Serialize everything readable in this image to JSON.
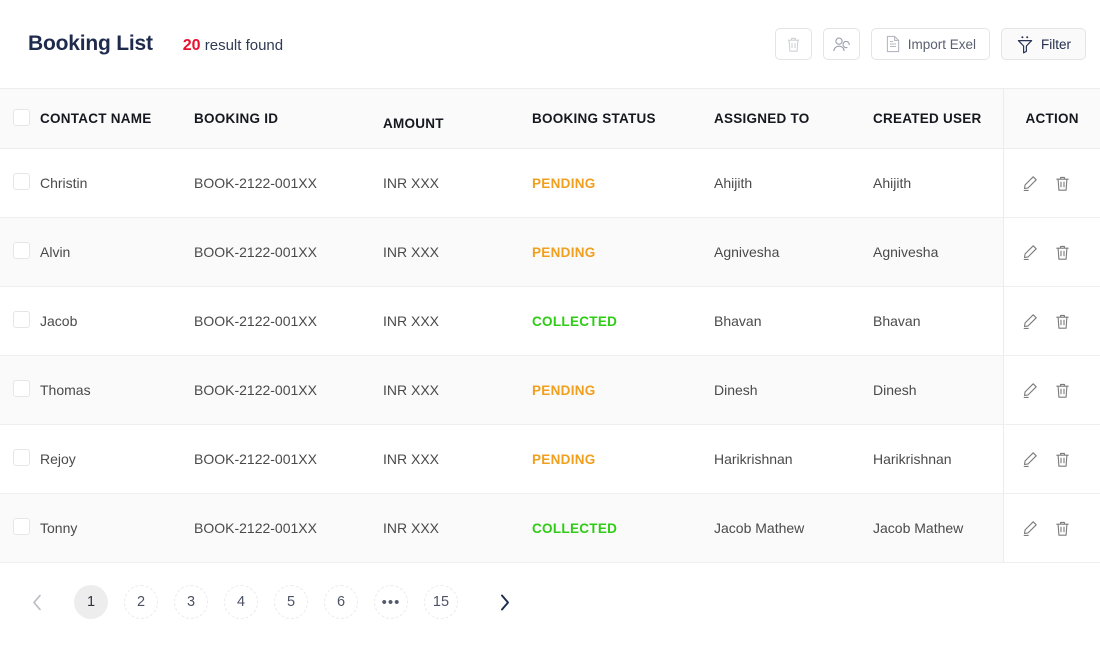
{
  "header": {
    "title": "Booking List",
    "result_count": "20",
    "result_text": "result found"
  },
  "toolbar": {
    "delete_label": "",
    "assign_label": "",
    "import_label": "Import Exel",
    "filter_label": "Filter",
    "icons": {
      "delete": "trash-icon",
      "assign": "assign-user-icon",
      "import": "document-icon",
      "filter": "funnel-icon"
    }
  },
  "table": {
    "columns": [
      "CONTACT NAME",
      "BOOKING ID",
      "AMOUNT",
      "BOOKING STATUS",
      "ASSIGNED TO",
      "CREATED USER",
      "ACTION"
    ],
    "rows": [
      {
        "name": "Christin",
        "booking_id": "BOOK-2122-001XX",
        "amount": "INR XXX",
        "status": "PENDING",
        "status_kind": "pending",
        "assigned_to": "Ahijith",
        "created_user": "Ahijith"
      },
      {
        "name": "Alvin",
        "booking_id": "BOOK-2122-001XX",
        "amount": "INR XXX",
        "status": "PENDING",
        "status_kind": "pending",
        "assigned_to": "Agnivesha",
        "created_user": "Agnivesha"
      },
      {
        "name": "Jacob",
        "booking_id": "BOOK-2122-001XX",
        "amount": "INR XXX",
        "status": "COLLECTED",
        "status_kind": "collected",
        "assigned_to": "Bhavan",
        "created_user": "Bhavan"
      },
      {
        "name": "Thomas",
        "booking_id": "BOOK-2122-001XX",
        "amount": "INR XXX",
        "status": "PENDING",
        "status_kind": "pending",
        "assigned_to": "Dinesh",
        "created_user": "Dinesh"
      },
      {
        "name": "Rejoy",
        "booking_id": "BOOK-2122-001XX",
        "amount": "INR XXX",
        "status": "PENDING",
        "status_kind": "pending",
        "assigned_to": "Harikrishnan",
        "created_user": "Harikrishnan"
      },
      {
        "name": "Tonny",
        "booking_id": "BOOK-2122-001XX",
        "amount": "INR XXX",
        "status": "COLLECTED",
        "status_kind": "collected",
        "assigned_to": "Jacob Mathew",
        "created_user": "Jacob Mathew"
      }
    ],
    "row_actions": {
      "edit": "edit-icon",
      "delete": "trash-icon"
    }
  },
  "pagination": {
    "prev": "‹",
    "next": "›",
    "pages": [
      "1",
      "2",
      "3",
      "4",
      "5",
      "6",
      "•••",
      "15"
    ],
    "active": "1"
  },
  "colors": {
    "accent_red": "#e8102b",
    "title_navy": "#1f2b4d",
    "pending": "#f0a01e",
    "collected": "#2ecc15",
    "header_bg": "#fafafa"
  }
}
